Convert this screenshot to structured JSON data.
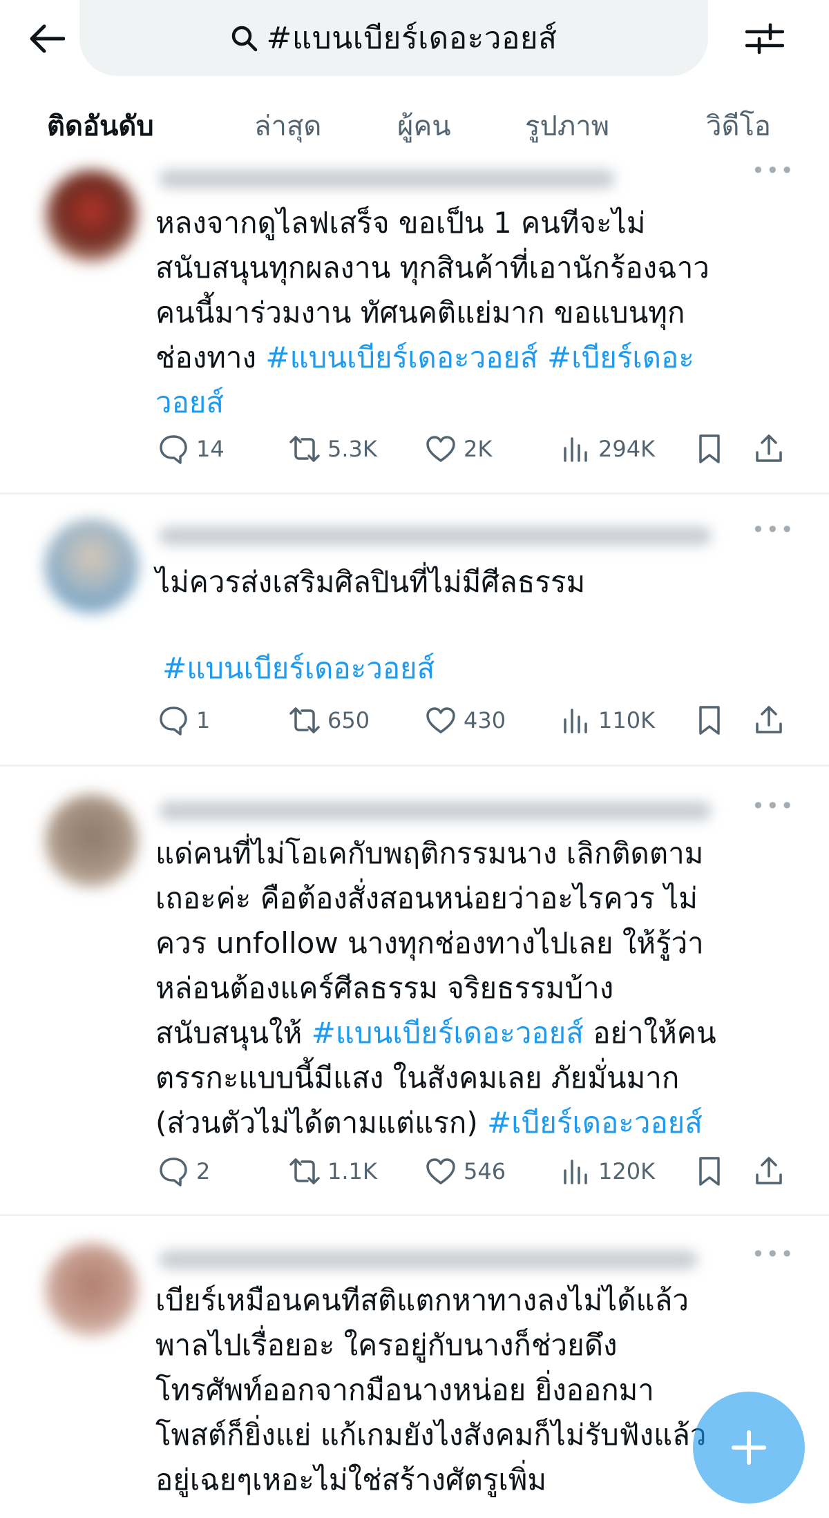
{
  "search": {
    "query": "#แบนเบียร์เดอะวอยส์"
  },
  "tabs": [
    {
      "label": "ติดอันดับ"
    },
    {
      "label": "ล่าสุด"
    },
    {
      "label": "ผู้คน"
    },
    {
      "label": "รูปภาพ"
    },
    {
      "label": "วิดีโอ"
    }
  ],
  "posts": [
    {
      "lines": [
        "หลงจากดูไลฟเสร็จ ขอเป็น 1 คนทีจะไม่",
        "สนับสนุนทุกผลงาน ทุกสินค้าที่เอานักร้องฉาว",
        "คนนี้มาร่วมงาน ทัศนคติแย่มาก ขอแบนทุก"
      ],
      "line4_text": "ช่องทาง ",
      "line4_tag1": "#แบนเบียร์เดอะวอยส์",
      "line4_tag2": " #เบียร์เดอะ",
      "line5_tag": "วอยส์",
      "replies": "14",
      "reposts": "5.3K",
      "likes": "2K",
      "views": "294K"
    },
    {
      "line1": "ไม่ควรส่งเสริมศิลปินที่ไม่มีศีลธรรม",
      "hashtag": "#แบนเบียร์เดอะวอยส์",
      "replies": "1",
      "reposts": "650",
      "likes": "430",
      "views": "110K"
    },
    {
      "lines": [
        "แด่คนที่ไม่โอเคกับพฤติกรรมนาง เลิกติดตาม",
        "เถอะค่ะ คือต้องสั่งสอนหน่อยว่าอะไรควร ไม่",
        "ควร unfollow นางทุกช่องทางไปเลย ให้รู้ว่า",
        "หล่อนต้องแคร์ศีลธรรม จริยธรรมบ้าง"
      ],
      "line5_pre": "สนับสนุนให้ ",
      "line5_tag": "#แบนเบียร์เดอะวอยส์",
      "line5_post": " อย่าให้คน",
      "line6": "ตรรกะแบบนี้มีแสง ในสังคมเลย ภัยมั่นมาก",
      "line7_pre": "(ส่วนตัวไม่ได้ตามแต่แรก) ",
      "line7_tag": "#เบียร์เดอะวอยส์",
      "replies": "2",
      "reposts": "1.1K",
      "likes": "546",
      "views": "120K"
    },
    {
      "lines": [
        "เบียร์เหมือนคนทีสติแตกหาทางลงไม่ได้แล้ว",
        "พาลไปเรื่อยอะ ใครอยู่กับนางก็ช่วยดึง",
        "โทรศัพท์ออกจากมือนางหน่อย ยิ่งออกมา",
        "โพสต์ก็ยิ่งแย่ แก้เกมยังไงสังคมก็ไม่รับฟังแล้ว",
        "อยู่เฉยๆเหอะไม่ใช่สร้างศัตรูเพิ่ม"
      ]
    }
  ],
  "colors": {
    "accent": "#1d9bf0",
    "text": "#0f1419",
    "muted": "#536471"
  },
  "icons": {
    "back": "arrow-left-icon",
    "search": "search-icon",
    "filter": "filter-sliders-icon",
    "reply": "reply-icon",
    "repost": "repost-icon",
    "like": "heart-icon",
    "views": "views-icon",
    "bookmark": "bookmark-icon",
    "share": "share-icon",
    "compose": "plus-icon"
  }
}
